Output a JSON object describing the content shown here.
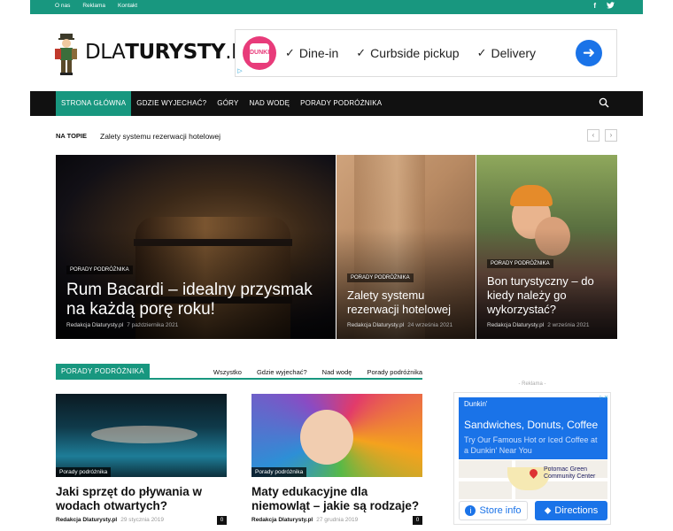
{
  "topbar": {
    "links": [
      "O nas",
      "Reklama",
      "Kontakt"
    ],
    "social": [
      {
        "name": "facebook-icon",
        "glyph": "f"
      },
      {
        "name": "twitter-icon",
        "glyph": "🐦"
      }
    ],
    "color": "#18977f"
  },
  "logo": {
    "prefix": "DLA",
    "main": "TURYSTY",
    "suffix": ".PL"
  },
  "ad_top": {
    "brand_badge": "DUNKIN",
    "options": [
      "Dine-in",
      "Curbside pickup",
      "Delivery"
    ],
    "adinfo": "▷"
  },
  "nav": {
    "items": [
      "STRONA GŁÓWNA",
      "GDZIE WYJECHAĆ?",
      "GÓRY",
      "NAD WODĘ",
      "PORADY PODRÓŻNIKA"
    ],
    "active_index": 0
  },
  "trending": {
    "label": "NA TOPIE",
    "title": "Zalety systemu rezerwacji hotelowej",
    "prev": "‹",
    "next": "›"
  },
  "hero": [
    {
      "category": "PORADY PODRÓŻNIKA",
      "title": "Rum Bacardi – idealny przysmak na każdą porę roku!",
      "author": "Redakcja Dlaturysty.pl",
      "date": "7 października 2021"
    },
    {
      "category": "PORADY PODRÓŻNIKA",
      "title": "Zalety systemu rezerwacji hotelowej",
      "author": "Redakcja Dlaturysty.pl",
      "date": "24 września 2021"
    },
    {
      "category": "PORADY PODRÓŻNIKA",
      "title": "Bon turystyczny – do kiedy należy go wykorzystać?",
      "author": "Redakcja Dlaturysty.pl",
      "date": "2 września 2021"
    }
  ],
  "section": {
    "tag": "PORADY PODRÓŻNIKA",
    "filters": [
      "Wszystko",
      "Gdzie wyjechać?",
      "Nad wodę",
      "Porady podróżnika"
    ]
  },
  "cards": [
    {
      "category": "Porady podróżnika",
      "title": "Jaki sprzęt do pływania w wodach otwartych?",
      "author": "Redakcja Dlaturysty.pl",
      "date": "29 stycznia 2019",
      "comments": "0"
    },
    {
      "category": "Porady podróżnika",
      "title": "Maty edukacyjne dla niemowląt – jakie są rodzaje?",
      "author": "Redakcja Dlaturysty.pl",
      "date": "27 grudnia 2019",
      "comments": "0"
    }
  ],
  "ad_side": {
    "label": "- Reklama -",
    "brand": "Dunkin'",
    "headline": "Sandwiches, Donuts, Coffee",
    "sub": "Try Our Famous Hot or Iced Coffee at a Dunkin' Near You",
    "map_label_1": "Potomac Green",
    "map_label_2": "Community Center",
    "store_btn": "Store info",
    "dir_btn": "Directions",
    "corner": "▷✕"
  }
}
